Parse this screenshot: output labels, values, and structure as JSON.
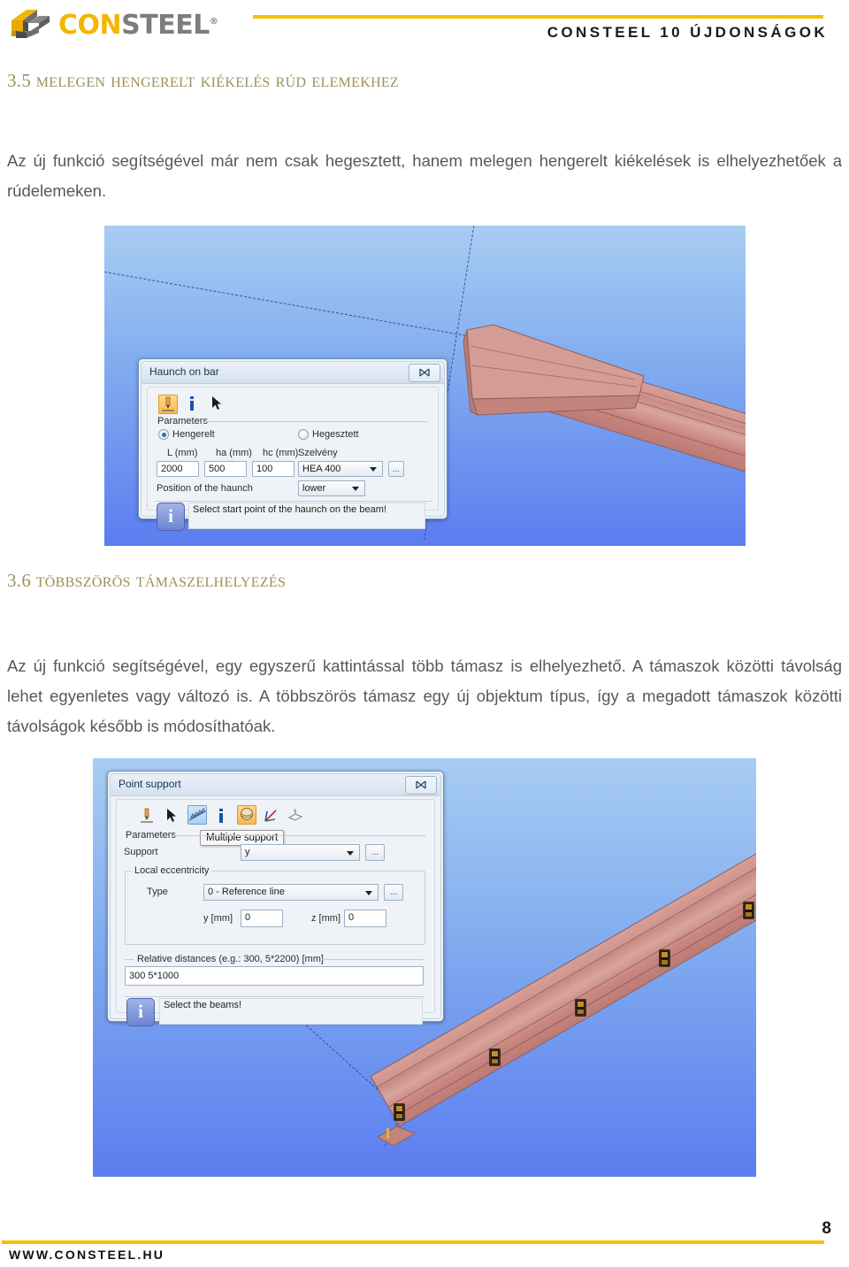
{
  "header": {
    "logo_con": "CON",
    "logo_steel": "STEEL",
    "logo_registered": "®",
    "title": "CONSTEEL 10 ÚJDONSÁGOK"
  },
  "sections": [
    {
      "number": "3.5",
      "title": "Melegen hengerelt kiékelés rúd elemekhez",
      "body": "Az új funkció segítségével már nem csak hegesztett, hanem melegen hengerelt kiékelések is elhelyezhetőek a rúdelemeken."
    },
    {
      "number": "3.6",
      "title": "Többszörös támaszelhelyezés",
      "body": "Az új funkció segítségével, egy egyszerű kattintással több támasz is elhelyezhető. A támaszok közötti távolság lehet egyenletes vagy változó is. A többszörös támasz egy új objektum típus, így a megadott támaszok közötti távolságok később is módosíthatóak."
    }
  ],
  "dialog_haunch": {
    "title": "Haunch on bar",
    "close_label": "✕",
    "toolbar": [
      {
        "icon": "haunch-tool-icon",
        "state": "selected"
      },
      {
        "icon": "info-icon",
        "state": "normal"
      },
      {
        "icon": "cursor-arrow-icon",
        "state": "normal"
      }
    ],
    "parameters_label": "Parameters",
    "radio_rolled": "Hengerelt",
    "radio_welded": "Hegesztett",
    "radio_selected": "Hengerelt",
    "fields": [
      {
        "label": "L (mm)",
        "value": "2000"
      },
      {
        "label": "ha (mm)",
        "value": "500"
      },
      {
        "label": "hc (mm)",
        "value": "100"
      }
    ],
    "section_label": "Szelvény",
    "section_value": "HEA 400",
    "browse_label": "...",
    "position_label": "Position of the haunch",
    "position_value": "lower",
    "status_badge": "i",
    "status_text": "Select start point of the haunch on the beam!"
  },
  "dialog_point_support": {
    "title": "Point support",
    "close_label": "✕",
    "toolbar": [
      {
        "icon": "pen-tool-icon",
        "state": "normal"
      },
      {
        "icon": "cursor-arrow-icon",
        "state": "normal"
      },
      {
        "icon": "multiple-support-icon",
        "state": "hover"
      },
      {
        "icon": "info-icon",
        "state": "normal"
      },
      {
        "icon": "sphere-support-icon",
        "state": "selected"
      },
      {
        "icon": "axes-icon",
        "state": "normal"
      },
      {
        "icon": "local-system-icon",
        "state": "normal"
      }
    ],
    "tooltip": "Multiple support",
    "parameters_label": "Parameters",
    "support_label": "Support",
    "support_value": "y",
    "support_browse": "...",
    "eccentricity_label": "Local eccentricity",
    "type_label": "Type",
    "type_value": "0 - Reference line",
    "type_browse": "...",
    "y_label": "y [mm]",
    "y_value": "0",
    "z_label": "z [mm]",
    "z_value": "0",
    "distances_label": "Relative distances (e.g.: 300, 5*2200) [mm]",
    "distances_value": "300 5*1000",
    "status_badge": "i",
    "status_text": "Select the beams!"
  },
  "viewports": {
    "haunch": {
      "model": "rolled-haunch-on-beam"
    },
    "supports": {
      "model": "beam-with-multiple-supports"
    }
  },
  "footer": {
    "page_number": "8",
    "url": "WWW.CONSTEEL.HU"
  },
  "colors": {
    "brand_yellow": "#f2c200",
    "heading_olive": "#9c9159",
    "body_gray": "#58585a",
    "viewport_blue": "#5b7df0",
    "steel_salmon": "#cf938c"
  }
}
